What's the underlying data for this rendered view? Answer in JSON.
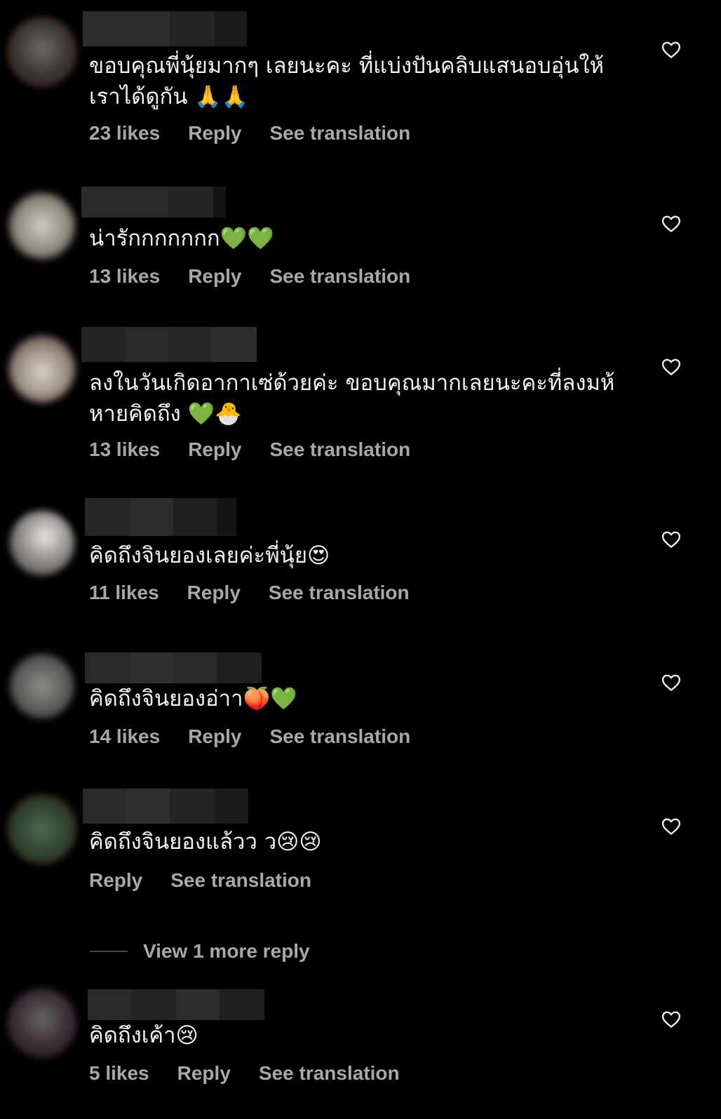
{
  "colors": {
    "background": "#000000",
    "text": "#f2f2f2",
    "muted": "#a8a8a8"
  },
  "icons": {
    "like": "heart-outline-icon"
  },
  "comments": [
    {
      "text": "ขอบคุณพี่นุ้ยมากๆ เลยนะคะ ที่แบ่งปันคลิบแสนอบอุ่นให้\nเราได้ดูกัน 🙏🙏",
      "likes": "23 likes",
      "reply": "Reply",
      "translate": "See translation"
    },
    {
      "text": "น่ารักกกกกกก💚💚",
      "likes": "13 likes",
      "reply": "Reply",
      "translate": "See translation"
    },
    {
      "text": "ลงในวันเกิดอากาเซ่ด้วยค่ะ ขอบคุณมากเลยนะคะที่ลงมห้\nหายคิดถึง 💚🐣",
      "likes": "13 likes",
      "reply": "Reply",
      "translate": "See translation"
    },
    {
      "text": "คิดถึงจินยองเลยค่ะพี่นุ้ย😍",
      "likes": "11 likes",
      "reply": "Reply",
      "translate": "See translation"
    },
    {
      "text": "คิดถึงจินยองอ่าา🍑💚",
      "likes": "14 likes",
      "reply": "Reply",
      "translate": "See translation"
    },
    {
      "text": "คิดถึงจินยองแล้วว ว😢😢",
      "likes": "",
      "reply": "Reply",
      "translate": "See translation"
    },
    {
      "text": "คิดถึงเค้า😢",
      "likes": "5 likes",
      "reply": "Reply",
      "translate": "See translation"
    }
  ],
  "view_more": "View 1 more reply"
}
